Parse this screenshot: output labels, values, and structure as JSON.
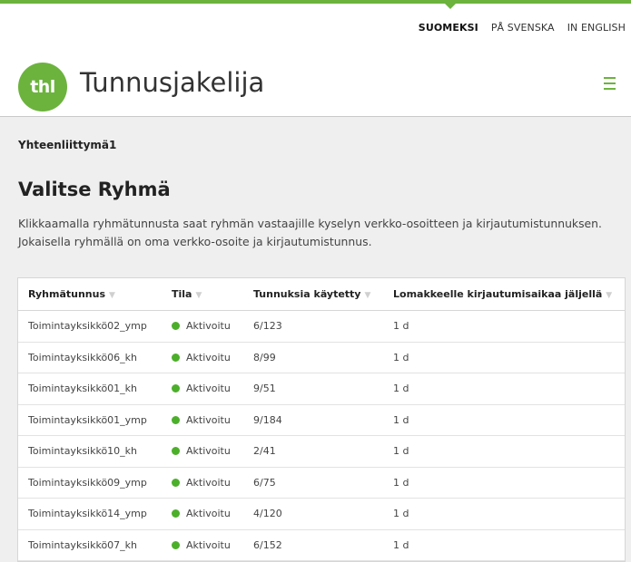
{
  "header": {
    "languages": [
      "SUOMEKSI",
      "PÅ SVENSKA",
      "IN ENGLISH"
    ],
    "active_language": "SUOMEKSI",
    "logo_text": "thl",
    "app_title": "Tunnusjakelija",
    "menu_icon": "hamburger-menu-icon",
    "accent_color": "#6cb33e"
  },
  "main": {
    "breadcrumb": "Yhteenliittymä1",
    "title": "Valitse Ryhmä",
    "description": "Klikkaamalla ryhmätunnusta saat ryhmän vastaajille kyselyn verkko-osoitteen ja kirjautumistunnuksen. Jokaisella ryhmällä on oma verkko-osoite ja kirjautumistunnus."
  },
  "table": {
    "columns": [
      "Ryhmätunnus",
      "Tila",
      "Tunnuksia käytetty",
      "Lomakkeelle kirjautumisaikaa jäljellä"
    ],
    "rows": [
      [
        "Toimintayksikkö02_ymp",
        "Aktivoitu",
        "6/123",
        "1 d"
      ],
      [
        "Toimintayksikkö06_kh",
        "Aktivoitu",
        "8/99",
        "1 d"
      ],
      [
        "Toimintayksikkö01_kh",
        "Aktivoitu",
        "9/51",
        "1 d"
      ],
      [
        "Toimintayksikkö01_ymp",
        "Aktivoitu",
        "9/184",
        "1 d"
      ],
      [
        "Toimintayksikkö10_kh",
        "Aktivoitu",
        "2/41",
        "1 d"
      ],
      [
        "Toimintayksikkö09_ymp",
        "Aktivoitu",
        "6/75",
        "1 d"
      ],
      [
        "Toimintayksikkö14_ymp",
        "Aktivoitu",
        "4/120",
        "1 d"
      ],
      [
        "Toimintayksikkö07_kh",
        "Aktivoitu",
        "6/152",
        "1 d"
      ]
    ],
    "status_color": "#4caf2a"
  }
}
